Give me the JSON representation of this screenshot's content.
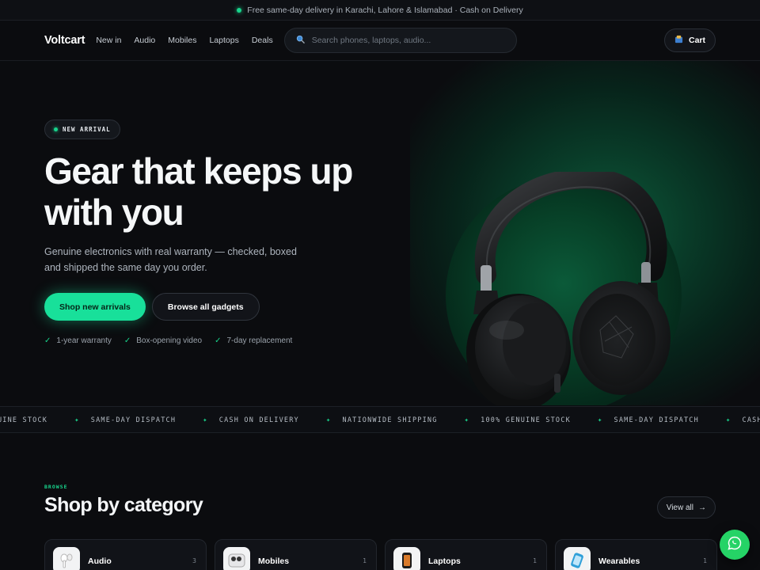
{
  "announcement": {
    "text": "Free same-day delivery in Karachi, Lahore & Islamabad · Cash on Delivery"
  },
  "nav": {
    "logo": "Voltcart",
    "links": [
      "New in",
      "Audio",
      "Mobiles",
      "Laptops",
      "Deals"
    ],
    "search_placeholder": "Search phones, laptops, audio...",
    "cart_label": "Cart"
  },
  "hero": {
    "badge": "NEW ARRIVAL",
    "headline_line1": "Gear that keeps up",
    "headline_line2": "with you",
    "subtext": "Genuine electronics with real warranty — checked, boxed and shipped the same day you order.",
    "primary_cta": "Shop new arrivals",
    "secondary_cta": "Browse all gadgets",
    "perks": [
      "1-year warranty",
      "Box-opening video",
      "7-day replacement"
    ]
  },
  "ticker": {
    "items": [
      "GENUINE STOCK",
      "SAME-DAY DISPATCH",
      "CASH ON DELIVERY",
      "NATIONWIDE SHIPPING",
      "100% GENUINE STOCK",
      "SAME-DAY DISPATCH",
      "CASH ON DELIVERY"
    ]
  },
  "categories_section": {
    "kicker": "BROWSE",
    "title": "Shop by category",
    "view_all": "View all",
    "cards": [
      {
        "name": "Audio",
        "count": "3"
      },
      {
        "name": "Mobiles",
        "count": "1"
      },
      {
        "name": "Laptops",
        "count": "1"
      },
      {
        "name": "Wearables",
        "count": "1"
      }
    ]
  },
  "colors": {
    "accent": "#18e09a",
    "background": "#0b0c0f",
    "whatsapp": "#25d366"
  },
  "icons": {
    "search": "search-icon",
    "cart": "cart-icon",
    "whatsapp": "whatsapp-icon",
    "check": "check-icon",
    "arrow": "arrow-right-icon"
  }
}
